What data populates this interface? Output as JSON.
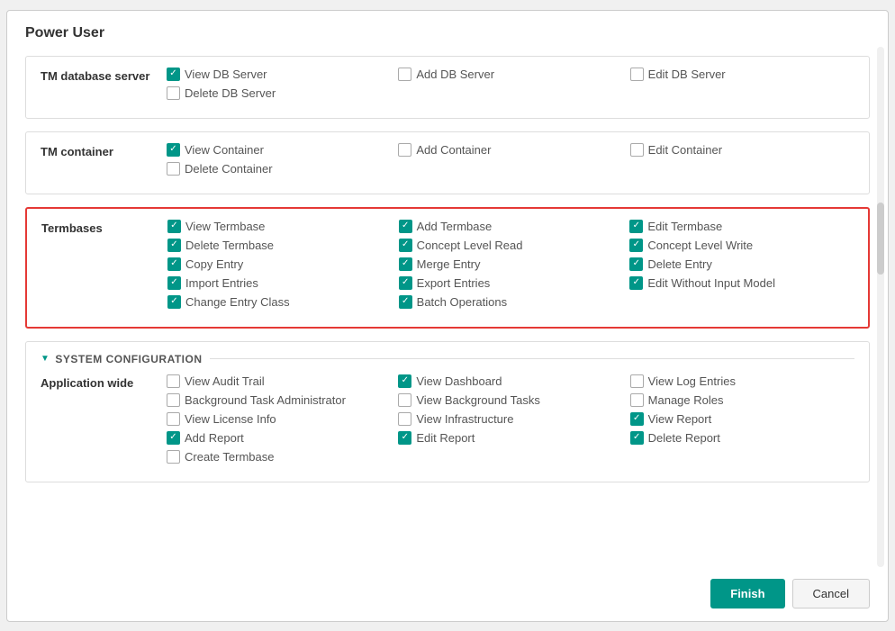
{
  "dialog": {
    "title": "Power User",
    "finish_label": "Finish",
    "cancel_label": "Cancel"
  },
  "sections": {
    "tm_db_server": {
      "label": "TM database server",
      "permissions": [
        {
          "label": "View DB Server",
          "checked": true
        },
        {
          "label": "Add DB Server",
          "checked": false
        },
        {
          "label": "Edit DB Server",
          "checked": false
        },
        {
          "label": "Delete DB Server",
          "checked": false
        }
      ]
    },
    "tm_container": {
      "label": "TM container",
      "permissions": [
        {
          "label": "View Container",
          "checked": true
        },
        {
          "label": "Add Container",
          "checked": false
        },
        {
          "label": "Edit Container",
          "checked": false
        },
        {
          "label": "Delete Container",
          "checked": false
        }
      ]
    },
    "termbases": {
      "label": "Termbases",
      "highlighted": true,
      "permissions": [
        {
          "label": "View Termbase",
          "checked": true
        },
        {
          "label": "Add Termbase",
          "checked": true
        },
        {
          "label": "Edit Termbase",
          "checked": true
        },
        {
          "label": "Delete Termbase",
          "checked": true
        },
        {
          "label": "Concept Level Read",
          "checked": true
        },
        {
          "label": "Concept Level Write",
          "checked": true
        },
        {
          "label": "Copy Entry",
          "checked": true
        },
        {
          "label": "Merge Entry",
          "checked": true
        },
        {
          "label": "Delete Entry",
          "checked": true
        },
        {
          "label": "Import Entries",
          "checked": true
        },
        {
          "label": "Export Entries",
          "checked": true
        },
        {
          "label": "Edit Without Input Model",
          "checked": true
        },
        {
          "label": "Change Entry Class",
          "checked": true
        },
        {
          "label": "Batch Operations",
          "checked": true
        }
      ]
    },
    "system_config": {
      "label": "SYSTEM CONFIGURATION",
      "application_wide": {
        "label": "Application wide",
        "permissions": [
          {
            "label": "View Audit Trail",
            "checked": false
          },
          {
            "label": "View Dashboard",
            "checked": true
          },
          {
            "label": "View Log Entries",
            "checked": false
          },
          {
            "label": "Background Task Administrator",
            "checked": false
          },
          {
            "label": "View Background Tasks",
            "checked": false
          },
          {
            "label": "Manage Roles",
            "checked": false
          },
          {
            "label": "View License Info",
            "checked": false
          },
          {
            "label": "View Infrastructure",
            "checked": false
          },
          {
            "label": "View Report",
            "checked": true
          },
          {
            "label": "Add Report",
            "checked": true
          },
          {
            "label": "Edit Report",
            "checked": true
          },
          {
            "label": "Delete Report",
            "checked": true
          },
          {
            "label": "Create Termbase",
            "checked": false
          }
        ]
      }
    }
  }
}
